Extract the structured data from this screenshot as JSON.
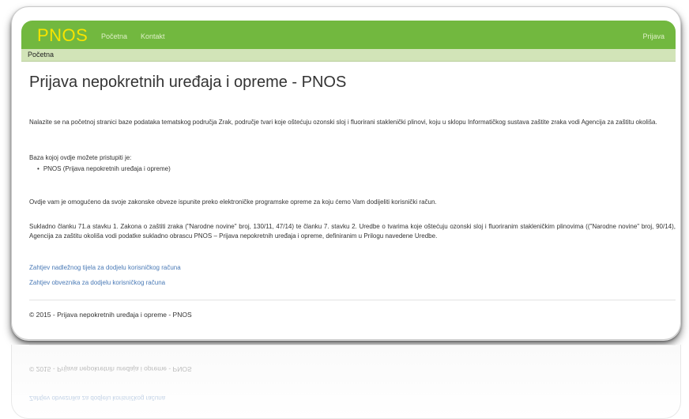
{
  "navbar": {
    "brand": "PNOS",
    "links": [
      "Početna",
      "Kontakt"
    ],
    "login": "Prijava"
  },
  "breadcrumb": "Početna",
  "page": {
    "title": "Prijava nepokretnih uređaja i opreme - PNOS",
    "intro": "Nalazite se na početnoj stranici baze podataka tematskog područja Zrak, područje tvari koje oštećuju ozonski sloj i fluorirani staklenički plinovi, koju u sklopu Informatičkog sustava zaštite zraka vodi Agencija za zaštitu okoliša.",
    "access_label": "Baza kojoj ovdje možete pristupiti je:",
    "list": [
      "PNOS (Prijava nepokretnih uređaja i opreme)"
    ],
    "obligation": "Ovdje vam je omogućeno da svoje zakonske obveze ispunite preko elektroničke programske opreme za koju ćemo Vam dodijeliti korisnički račun.",
    "legal": "Sukladno članku 71.a stavku 1. Zakona o zaštiti zraka (\"Narodne novine\" broj, 130/11, 47/14) te članku 7. stavku 2. Uredbe o tvarima koje oštećuju ozonski sloj i fluoriranim stakleničkim plinovima ((\"Narodne novine\" broj, 90/14), Agencija za zaštitu okoliša vodi podatke sukladno obrascu PNOS – Prijava nepokretnih uređaja i opreme, definiranim u Prilogu navedene Uredbe.",
    "links": [
      "Zahtjev nadležnog tijela za dodjelu korisničkog računa",
      "Zahtjev obveznika za dodjelu korisničkog računa"
    ]
  },
  "footer": "© 2015 - Prijava nepokretnih uređaja i opreme - PNOS",
  "colors": {
    "navbar": "#72b83f",
    "brand": "#f7e400",
    "breadcrumb": "#d2e4b8",
    "link": "#4a7ab6"
  }
}
